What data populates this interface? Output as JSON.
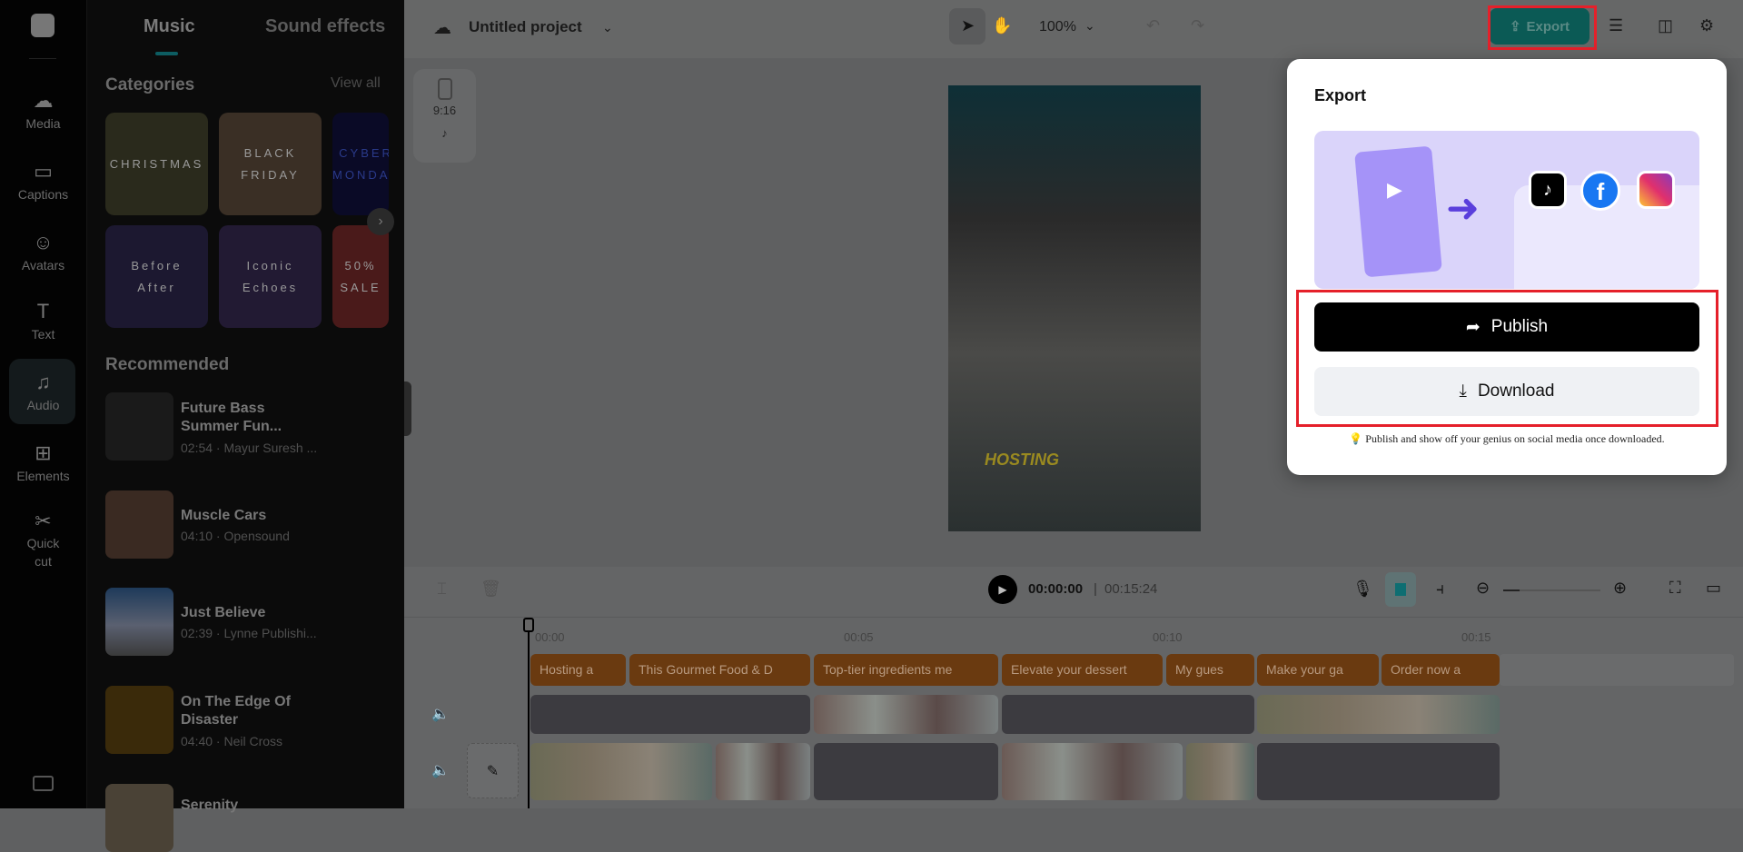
{
  "nav": {
    "items": [
      {
        "label": "Media",
        "icon": "cloud-upload-icon"
      },
      {
        "label": "Captions",
        "icon": "captions-icon"
      },
      {
        "label": "Avatars",
        "icon": "avatar-icon"
      },
      {
        "label": "Text",
        "icon": "text-icon"
      },
      {
        "label": "Audio",
        "icon": "music-icon",
        "active": true
      },
      {
        "label": "Elements",
        "icon": "elements-icon"
      },
      {
        "label": "Quick cut",
        "icon": "quick-cut-icon"
      }
    ]
  },
  "panel": {
    "tabs": [
      "Music",
      "Sound effects"
    ],
    "categories_title": "Categories",
    "view_all": "View all",
    "categories": [
      "CHRISTMAS",
      "BLACK FRIDAY",
      "CYBER MONDAY",
      "Before After",
      "Iconic Echoes",
      "50% SALE"
    ],
    "recommended_title": "Recommended",
    "songs": [
      {
        "title": "Future Bass Summer Fun...",
        "meta": "02:54 · Mayur Suresh ..."
      },
      {
        "title": "Muscle Cars",
        "meta": "04:10 · Opensound"
      },
      {
        "title": "Just Believe",
        "meta": "02:39 · Lynne Publishi..."
      },
      {
        "title": "On The Edge Of Disaster",
        "meta": "04:40 · Neil Cross"
      },
      {
        "title": "Serenity",
        "meta": ""
      }
    ]
  },
  "topbar": {
    "project": "Untitled project",
    "zoom": "100%",
    "export": "Export"
  },
  "canvas": {
    "ratio": "9:16",
    "caption": "HOSTING"
  },
  "timeline": {
    "current": "00:00:00",
    "total": "00:15:24",
    "ticks": [
      "00:00",
      "00:05",
      "00:10",
      "00:15"
    ],
    "captions": [
      "Hosting a",
      "This Gourmet Food & D",
      "Top-tier ingredients me",
      "Elevate your dessert",
      "My gues",
      "Make your ga",
      "Order now a"
    ]
  },
  "export": {
    "title": "Export",
    "publish": "Publish",
    "download": "Download",
    "tip": "Publish and show off your genius on social media once downloaded."
  },
  "colors": {
    "accent": "#0b5a55",
    "highlight": "#e5202a"
  }
}
